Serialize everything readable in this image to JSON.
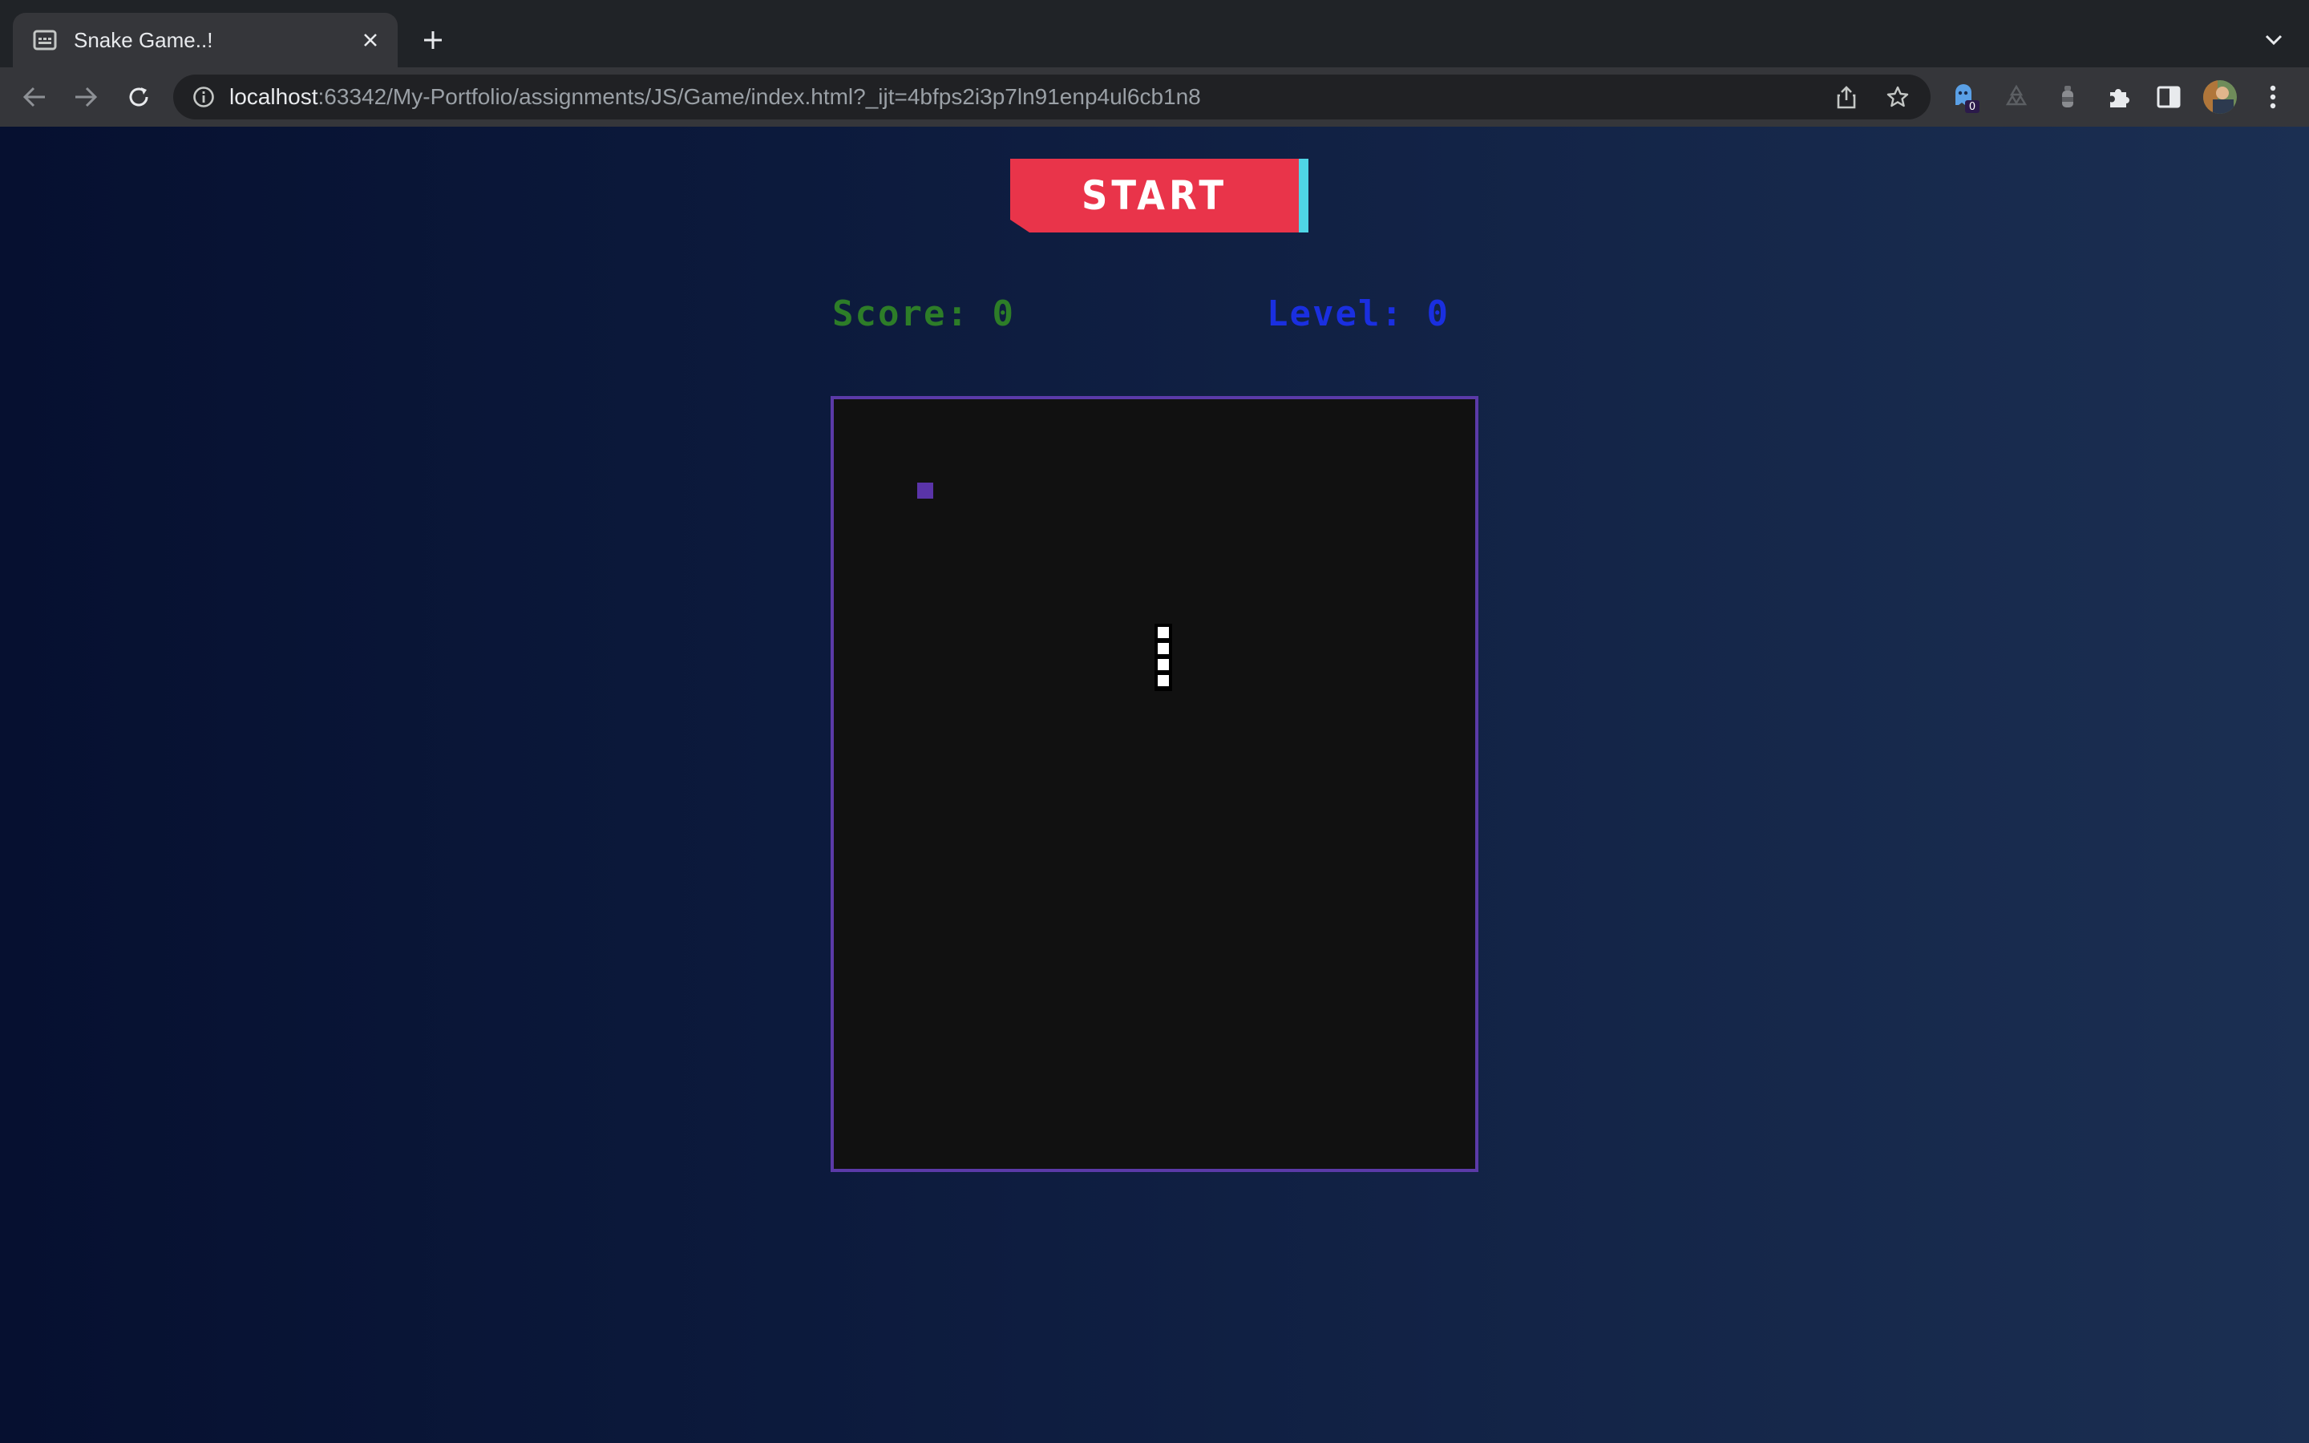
{
  "browser": {
    "tab": {
      "title": "Snake Game..!",
      "favicon": "window-icon",
      "close_icon": "close-icon"
    },
    "new_tab_icon": "plus-icon",
    "tab_menu_icon": "chevron-down-icon",
    "nav": {
      "back_icon": "back-arrow-icon",
      "forward_icon": "forward-arrow-icon",
      "reload_icon": "reload-icon"
    },
    "address": {
      "info_icon": "info-icon",
      "host": "localhost",
      "path": ":63342/My-Portfolio/assignments/JS/Game/index.html?_ijt=4bfps2i3p7ln91enp4ul6cb1n8",
      "share_icon": "share-icon",
      "bookmark_icon": "star-icon"
    },
    "extensions": {
      "ghost_badge": "0",
      "icons": [
        "ghost-extension-icon",
        "recycle-extension-icon",
        "bottle-extension-icon",
        "puzzle-icon",
        "sidepanel-icon",
        "profile-avatar",
        "more-vert-icon"
      ]
    }
  },
  "game": {
    "start_label": "START",
    "score_label": "Score:",
    "score_value": "0",
    "level_label": "Level:",
    "level_value": "0",
    "colors": {
      "start_button": "#e9344a",
      "start_accent": "#4fd5e6",
      "score_text": "#2d7d28",
      "level_text": "#1a2fe0",
      "board_border": "#5b3aa8",
      "board_bg": "#111111",
      "food": "#5a34a8",
      "snake": "#ffffff"
    },
    "snake_length": 4
  }
}
